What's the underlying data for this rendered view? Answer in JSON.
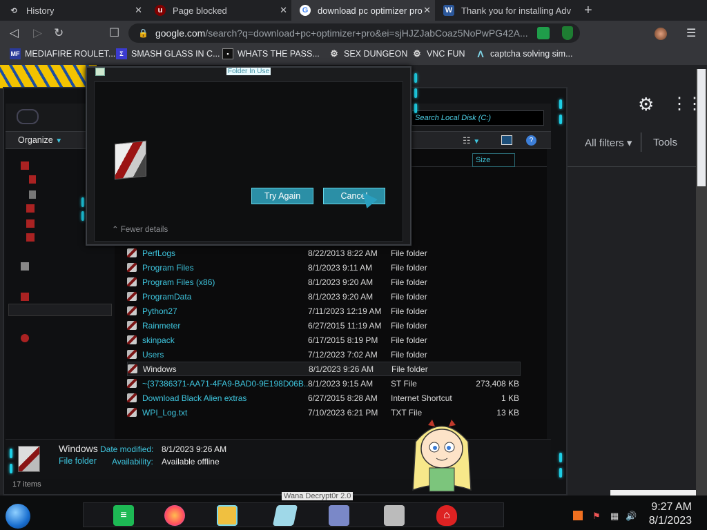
{
  "tabs": [
    {
      "label": "History",
      "icon": "history-icon"
    },
    {
      "label": "Page blocked",
      "icon": "ublock-icon"
    },
    {
      "label": "download pc optimizer pro",
      "icon": "google-icon"
    },
    {
      "label": "Thank you for installing Adv",
      "icon": "word-icon"
    }
  ],
  "omnibox": {
    "host": "google.com",
    "path": "/search?q=download+pc+optimizer+pro&ei=sjHJZJabCoaz5NoPwPG42A..."
  },
  "bookmarks": [
    {
      "label": "MEDIAFIRE ROULET..."
    },
    {
      "label": "SMASH GLASS IN C..."
    },
    {
      "label": "WHATS THE PASS..."
    },
    {
      "label": "SEX DUNGEON"
    },
    {
      "label": "VNC FUN"
    },
    {
      "label": "captcha solving sim..."
    }
  ],
  "google": {
    "all_filters": "All filters",
    "tools": "Tools"
  },
  "explorer": {
    "organize": "Organize",
    "search_placeholder": "Search Local Disk (C:)",
    "size_header": "Size",
    "rows": [
      {
        "name": "PerfLogs",
        "date": "8/22/2013 8:22 AM",
        "type": "File folder",
        "size": ""
      },
      {
        "name": "Program Files",
        "date": "8/1/2023 9:11 AM",
        "type": "File folder",
        "size": ""
      },
      {
        "name": "Program Files (x86)",
        "date": "8/1/2023 9:20 AM",
        "type": "File folder",
        "size": ""
      },
      {
        "name": "ProgramData",
        "date": "8/1/2023 9:20 AM",
        "type": "File folder",
        "size": ""
      },
      {
        "name": "Python27",
        "date": "7/11/2023 12:19 AM",
        "type": "File folder",
        "size": ""
      },
      {
        "name": "Rainmeter",
        "date": "6/27/2015 11:19 AM",
        "type": "File folder",
        "size": ""
      },
      {
        "name": "skinpack",
        "date": "6/17/2015 8:19 PM",
        "type": "File folder",
        "size": ""
      },
      {
        "name": "Users",
        "date": "7/12/2023 7:02 AM",
        "type": "File folder",
        "size": ""
      },
      {
        "name": "Windows",
        "date": "8/1/2023 9:26 AM",
        "type": "File folder",
        "size": ""
      },
      {
        "name": "~{37386371-AA71-4FA9-BAD0-9E198D06B...",
        "date": "8/1/2023 9:15 AM",
        "type": "ST File",
        "size": "273,408 KB"
      },
      {
        "name": "Download Black Alien extras",
        "date": "6/27/2015 8:28 AM",
        "type": "Internet Shortcut",
        "size": "1 KB"
      },
      {
        "name": "WPI_Log.txt",
        "date": "7/10/2023 6:21 PM",
        "type": "TXT File",
        "size": "13 KB"
      }
    ],
    "details": {
      "name": "Windows",
      "type": "File folder",
      "date_key": "Date modified:",
      "date_val": "8/1/2023 9:26 AM",
      "avail_key": "Availability:",
      "avail_val": "Available offline"
    },
    "status": "17 items"
  },
  "dialog": {
    "title": "Folder In Use",
    "try_again": "Try Again",
    "cancel": "Cancel",
    "fewer_details": "Fewer details"
  },
  "taskbar": {
    "tooltip": "Wana Decrypt0r 2.0",
    "time": "9:27 AM",
    "date": "8/1/2023"
  }
}
